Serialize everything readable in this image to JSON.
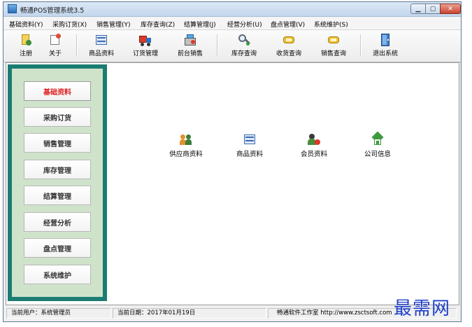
{
  "window": {
    "title": "畅通POS管理系统3.5"
  },
  "menu": [
    {
      "label": "基础资料(Y)"
    },
    {
      "label": "采购订货(X)"
    },
    {
      "label": "销售管理(Y)"
    },
    {
      "label": "库存查询(Z)"
    },
    {
      "label": "结算管理(J)"
    },
    {
      "label": "经营分析(U)"
    },
    {
      "label": "盘点管理(V)"
    },
    {
      "label": "系统维护(S)"
    }
  ],
  "toolbar": [
    {
      "label": "注册",
      "icon": "register-icon"
    },
    {
      "label": "关于",
      "icon": "about-icon"
    },
    {
      "label": "商品资料",
      "icon": "product-grid-icon"
    },
    {
      "label": "订货管理",
      "icon": "truck-icon"
    },
    {
      "label": "前台销售",
      "icon": "cash-register-icon"
    },
    {
      "label": "库存查询",
      "icon": "magnifier-icon"
    },
    {
      "label": "收货查询",
      "icon": "receive-icon"
    },
    {
      "label": "销售查询",
      "icon": "sales-query-icon"
    },
    {
      "label": "退出系统",
      "icon": "exit-door-icon"
    }
  ],
  "sidebar": [
    {
      "label": "基础资料",
      "active": true
    },
    {
      "label": "采购订货"
    },
    {
      "label": "销售管理"
    },
    {
      "label": "库存管理"
    },
    {
      "label": "结算管理"
    },
    {
      "label": "经营分析"
    },
    {
      "label": "盘点管理"
    },
    {
      "label": "系统维护"
    }
  ],
  "modules": [
    {
      "label": "供应商资料",
      "icon": "suppliers-icon"
    },
    {
      "label": "商品资料",
      "icon": "product-grid-icon"
    },
    {
      "label": "会员资料",
      "icon": "members-icon"
    },
    {
      "label": "公司信息",
      "icon": "company-house-icon"
    }
  ],
  "status": {
    "user": "当前用户：系统管理员",
    "date": "当前日期：2017年01月19日",
    "vendor": "畅通软件工作室 http://www.zsctsoft.com"
  },
  "watermark": "最需网",
  "colors": {
    "sidebar_frame": "#1c7c73",
    "sidebar_bg": "#cfe3cb",
    "active_text": "#e02020",
    "watermark": "#1f3fc9"
  }
}
